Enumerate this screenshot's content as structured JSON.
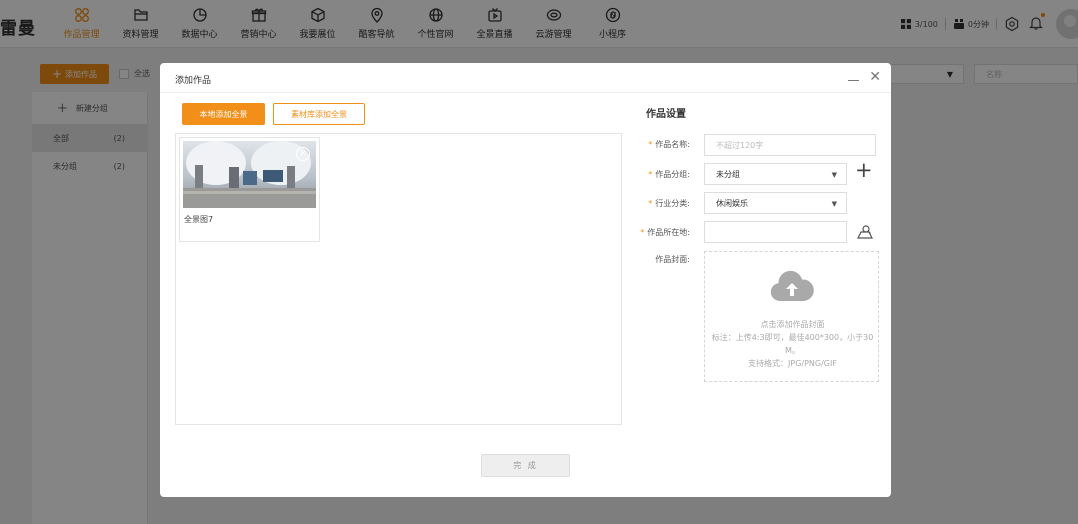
{
  "app": {
    "logo_text": "雷曼"
  },
  "nav": {
    "items": [
      {
        "label": "作品管理",
        "icon": "grid-icon",
        "active": true
      },
      {
        "label": "资料管理",
        "icon": "folder-icon"
      },
      {
        "label": "数据中心",
        "icon": "pie-chart-icon"
      },
      {
        "label": "营销中心",
        "icon": "gift-icon"
      },
      {
        "label": "我要展位",
        "icon": "cube-icon"
      },
      {
        "label": "酷客导航",
        "icon": "location-pin-icon"
      },
      {
        "label": "个性官网",
        "icon": "globe-icon"
      },
      {
        "label": "全景直播",
        "icon": "tv-icon"
      },
      {
        "label": "云游管理",
        "icon": "cloud-tour-icon"
      },
      {
        "label": "小程序",
        "icon": "mini-program-icon"
      }
    ]
  },
  "toolbar": {
    "quota_text": "3/100",
    "time_text": "0分钟"
  },
  "subbar": {
    "add_label": "添加作品",
    "select_all_label": "全选",
    "search_placeholder": "名称"
  },
  "sidebar": {
    "new_group_label": "新建分组",
    "groups": [
      {
        "name": "全部",
        "count": "(2)"
      },
      {
        "name": "未分组",
        "count": "(2)"
      }
    ]
  },
  "modal": {
    "title": "添加作品",
    "tab_local": "本地添加全景",
    "tab_library": "素材库添加全景",
    "item_name": "全景图7",
    "settings_title": "作品设置",
    "form": {
      "name_label": "作品名称:",
      "name_placeholder": "不超过120字",
      "group_label": "作品分组:",
      "group_value": "未分组",
      "industry_label": "行业分类:",
      "industry_value": "休闲娱乐",
      "location_label": "作品所在地:",
      "cover_label": "作品封面:"
    },
    "cover": {
      "line1": "点击添加作品封面",
      "line2": "标注：上传4:3即可，最佳400*300，小于30",
      "line3": "M。",
      "line4": "支持格式：JPG/PNG/GIF"
    },
    "done_label": "完 成"
  },
  "colors": {
    "accent": "#f28f18",
    "overlay": "rgba(0,0,0,0.48)"
  }
}
